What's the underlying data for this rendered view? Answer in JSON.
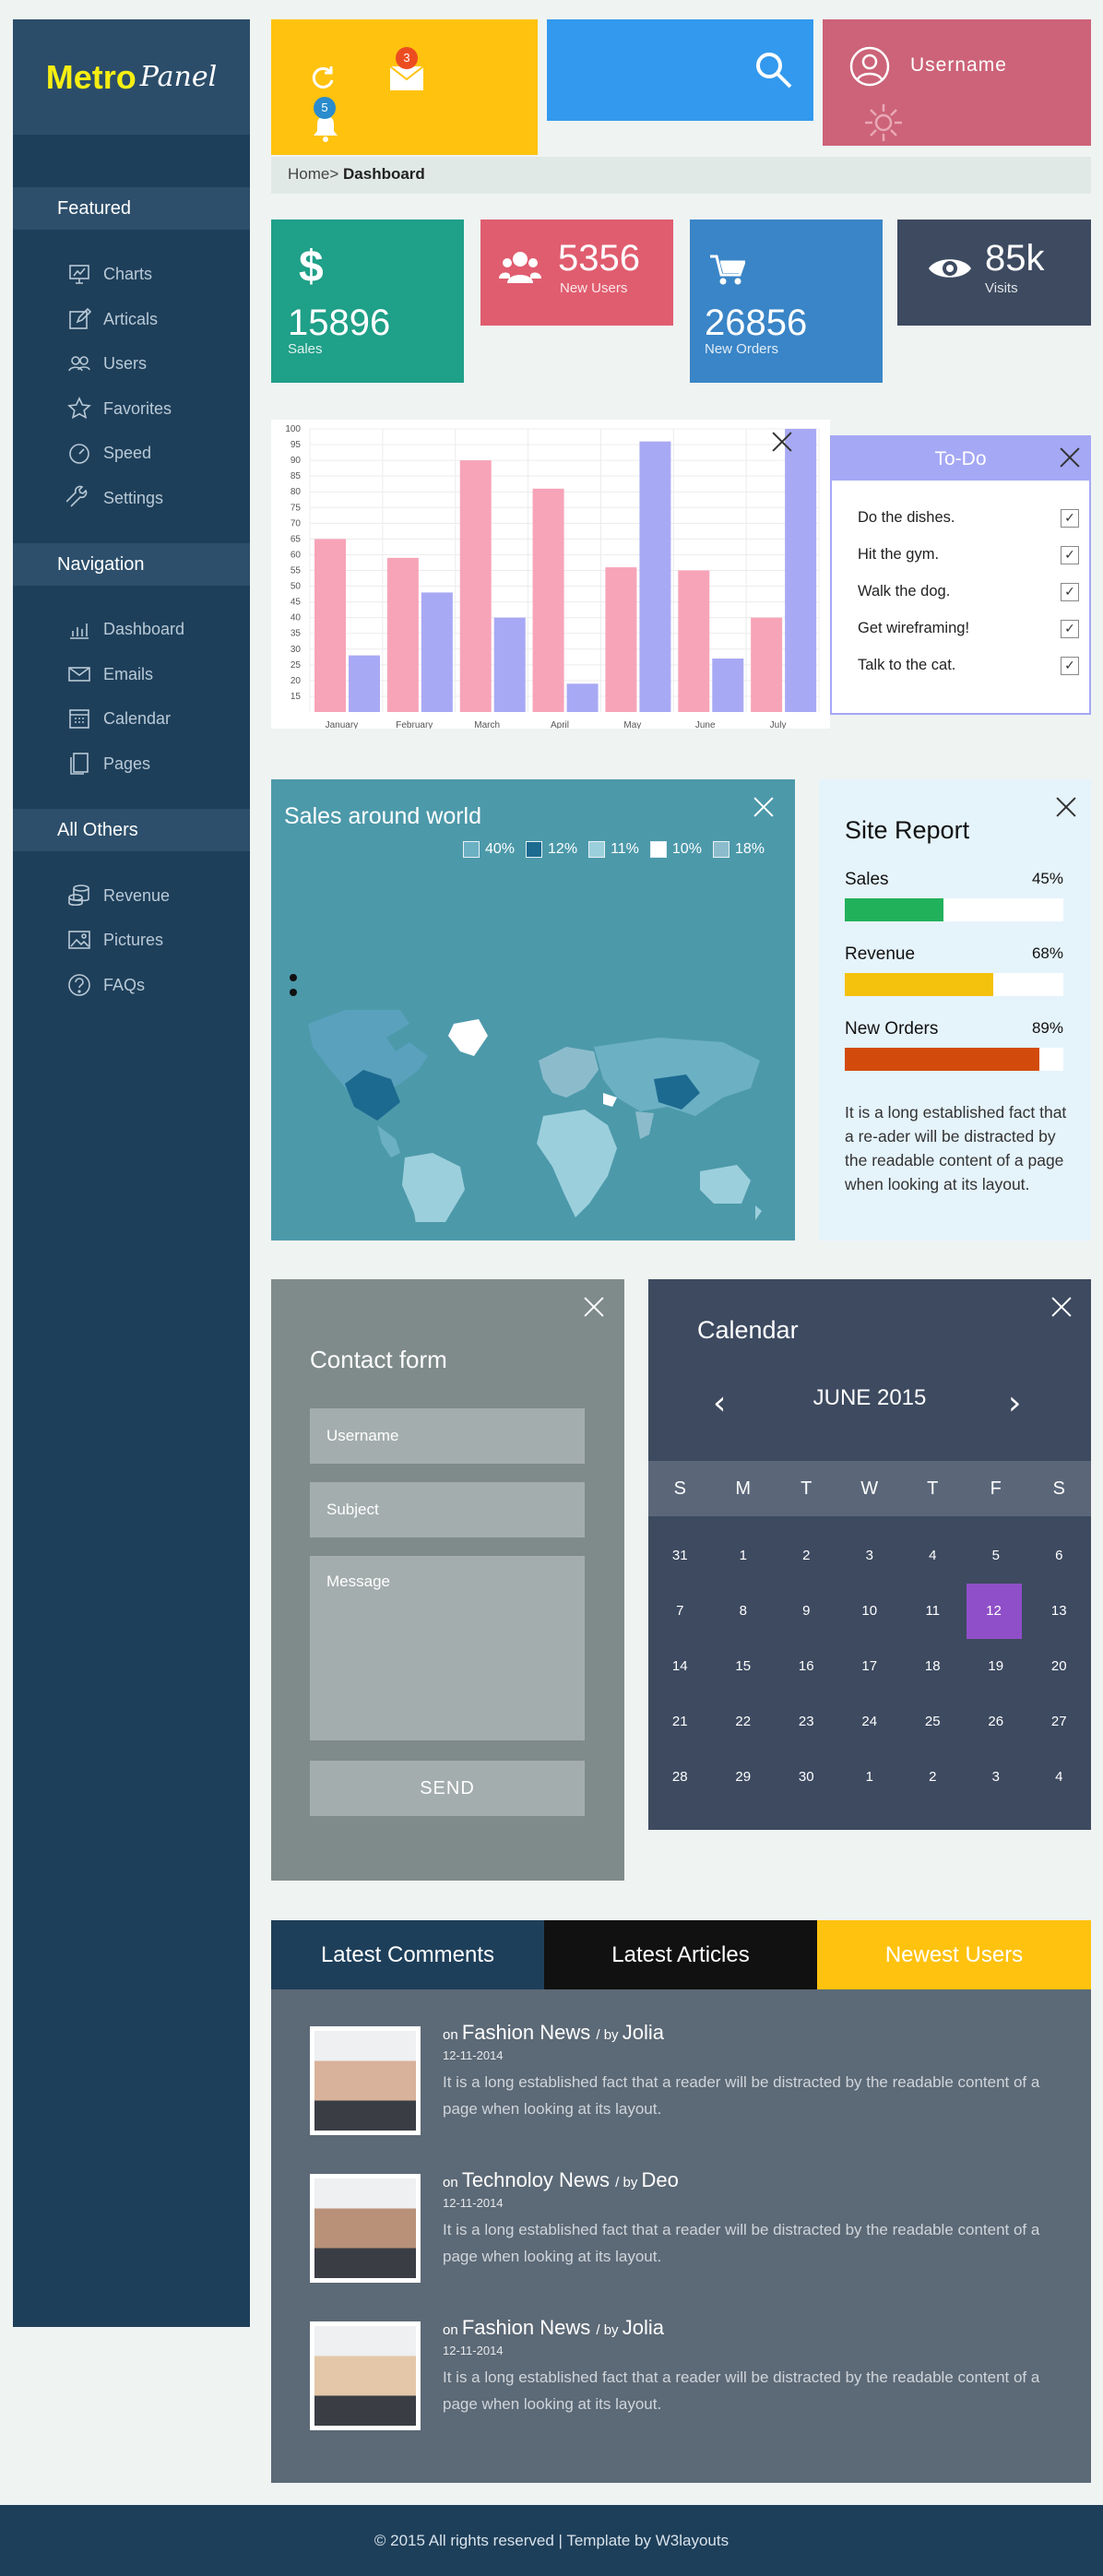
{
  "brand": {
    "metro": "Metro",
    "panel": "Panel"
  },
  "sidebar": {
    "sections": [
      {
        "title": "Featured",
        "items": [
          {
            "label": "Charts",
            "icon": "presentation-chart-icon"
          },
          {
            "label": "Articals",
            "icon": "edit-icon"
          },
          {
            "label": "Users",
            "icon": "users-icon"
          },
          {
            "label": "Favorites",
            "icon": "star-icon"
          },
          {
            "label": "Speed",
            "icon": "gauge-icon"
          },
          {
            "label": "Settings",
            "icon": "wrench-icon"
          }
        ]
      },
      {
        "title": "Navigation",
        "items": [
          {
            "label": "Dashboard",
            "icon": "bar-chart-icon"
          },
          {
            "label": "Emails",
            "icon": "envelope-icon"
          },
          {
            "label": "Calendar",
            "icon": "calendar-icon"
          },
          {
            "label": "Pages",
            "icon": "pages-icon"
          }
        ]
      },
      {
        "title": "All Others",
        "items": [
          {
            "label": "Revenue",
            "icon": "coins-icon"
          },
          {
            "label": "Pictures",
            "icon": "picture-icon"
          },
          {
            "label": "FAQs",
            "icon": "question-icon"
          }
        ]
      }
    ]
  },
  "top": {
    "mail_count": "3",
    "notify_count": "5",
    "username": "Username"
  },
  "breadcrumb": {
    "home": "Home>",
    "current": "Dashboard"
  },
  "stats": [
    {
      "value": "15896",
      "label": "Sales",
      "color": "#1fa088",
      "icon": "dollar-icon"
    },
    {
      "value": "5356",
      "label": "New Users",
      "color": "#e05d6f",
      "icon": "users-icon"
    },
    {
      "value": "26856",
      "label": "New Orders",
      "color": "#3a85c7",
      "icon": "cart-icon"
    },
    {
      "value": "85k",
      "label": "Visits",
      "color": "#3d4a60",
      "icon": "eye-icon"
    }
  ],
  "chart_data": {
    "type": "bar",
    "categories": [
      "January",
      "February",
      "March",
      "April",
      "May",
      "June",
      "July"
    ],
    "series": [
      {
        "values": [
          65,
          59,
          90,
          81,
          56,
          55,
          40
        ],
        "color": "#f7a4b8"
      },
      {
        "values": [
          28,
          48,
          40,
          19,
          96,
          27,
          100
        ],
        "color": "#a8a9f4"
      }
    ],
    "ylim": [
      10,
      100
    ],
    "yticks": [
      "100",
      "95",
      "90",
      "85",
      "80",
      "75",
      "70",
      "65",
      "60",
      "55",
      "50",
      "45",
      "40",
      "35",
      "30",
      "25",
      "20",
      "15"
    ],
    "grid": true
  },
  "todo": {
    "title": "To-Do",
    "items": [
      "Do the dishes.",
      "Hit the gym.",
      "Walk the dog.",
      "Get wireframing!",
      "Talk to the cat."
    ]
  },
  "map": {
    "title": "Sales around world",
    "legend": [
      {
        "label": "40%",
        "color": "#6cb0c4"
      },
      {
        "label": "12%",
        "color": "#1c6a90"
      },
      {
        "label": "11%",
        "color": "#9ccfdc"
      },
      {
        "label": "10%",
        "color": "#ffffff"
      },
      {
        "label": "18%",
        "color": "#8cbccc"
      }
    ]
  },
  "report": {
    "title": "Site Report",
    "bars": [
      {
        "label": "Sales",
        "percent_text": "45%",
        "value": 0.45,
        "color": "#22b15b"
      },
      {
        "label": "Revenue",
        "percent_text": "68%",
        "value": 0.68,
        "color": "#f4c20d"
      },
      {
        "label": "New Orders",
        "percent_text": "89%",
        "value": 0.89,
        "color": "#d34b0c"
      }
    ],
    "text": "It is a long established fact that a re-ader will be distracted by the readable content of a page when looking at its layout."
  },
  "contact": {
    "title": "Contact form",
    "username_placeholder": "Username",
    "subject_placeholder": "Subject",
    "message_placeholder": "Message",
    "send_label": "SEND"
  },
  "calendar": {
    "title": "Calendar",
    "month": "JUNE 2015",
    "weekdays": [
      "S",
      "M",
      "T",
      "W",
      "T",
      "F",
      "S"
    ],
    "weeks": [
      [
        "31",
        "1",
        "2",
        "3",
        "4",
        "5",
        "6"
      ],
      [
        "7",
        "8",
        "9",
        "10",
        "11",
        "12",
        "13"
      ],
      [
        "14",
        "15",
        "16",
        "17",
        "18",
        "19",
        "20"
      ],
      [
        "21",
        "22",
        "23",
        "24",
        "25",
        "26",
        "27"
      ],
      [
        "28",
        "29",
        "30",
        "1",
        "2",
        "3",
        "4"
      ]
    ],
    "highlight": "12"
  },
  "tabs": [
    {
      "label": "Latest Comments",
      "bg": "#1e3f5a",
      "fg": "#ffffff"
    },
    {
      "label": "Latest Articles",
      "bg": "#111111",
      "fg": "#ffffff"
    },
    {
      "label": "Newest Users",
      "bg": "#ffc20e",
      "fg": "#ffffff"
    }
  ],
  "articles": [
    {
      "on": "on",
      "topic": "Fashion News",
      "by": "/ by",
      "author": "Jolia",
      "date": "12-11-2014",
      "text": "It is a long established fact that a reader will be distracted by the readable content of a page when looking at its layout."
    },
    {
      "on": "on",
      "topic": "Technoloy News",
      "by": "/ by",
      "author": "Deo",
      "date": "12-11-2014",
      "text": "It is a long established fact that a reader will be distracted by the readable content of a page when looking at its layout."
    },
    {
      "on": "on",
      "topic": "Fashion News",
      "by": "/ by",
      "author": "Jolia",
      "date": "12-11-2014",
      "text": "It is a long established fact that a reader will be distracted by the readable content of a page when looking at its layout."
    }
  ],
  "footer": {
    "text": "© 2015 All rights reserved | Template by W3layouts"
  }
}
